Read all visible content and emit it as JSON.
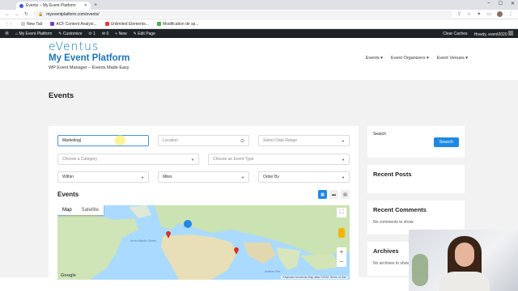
{
  "browser": {
    "tab_title": "Events – My Event Platform",
    "url": "myeventplatform.com/events/",
    "bookmarks": [
      "New Tab",
      "ACF Content Analysi...",
      "Unlimited Elements...",
      "Modification de sp..."
    ]
  },
  "adminbar": {
    "site": "My Event Platform",
    "customize": "Customize",
    "updates": "1",
    "comments": "0",
    "new": "New",
    "edit": "Edit Page",
    "clear_caches": "Clear Caches",
    "howdy": "Howdy, event2020"
  },
  "header": {
    "logo": "eVentus",
    "site_title": "My Event Platform",
    "tagline": "WP Event Manager – Events Made Easy",
    "nav": [
      "Events",
      "Event Organizers",
      "Event Venues"
    ]
  },
  "page_title": "Events",
  "filters": {
    "keyword_value": "Marketing",
    "location_placeholder": "Location",
    "date_range": "Select Date Range",
    "category": "Choose a Category",
    "event_type": "Choose an Event Type",
    "within": "Within",
    "miles": "Miles",
    "order_by": "Order By"
  },
  "events_heading": "Events",
  "map": {
    "map_label": "Map",
    "satellite_label": "Satellite",
    "google": "Google",
    "attribution": "Keyboard shortcuts   Map data ©2022   Terms of Use",
    "labels": [
      "North Atlantic Ocean",
      "Arabian Sea"
    ]
  },
  "sidebar": {
    "search_title": "Search",
    "search_button": "Search",
    "recent_posts": "Recent Posts",
    "recent_comments": "Recent Comments",
    "no_comments": "No comments to show.",
    "archives": "Archives",
    "no_archives": "No archives to show."
  }
}
